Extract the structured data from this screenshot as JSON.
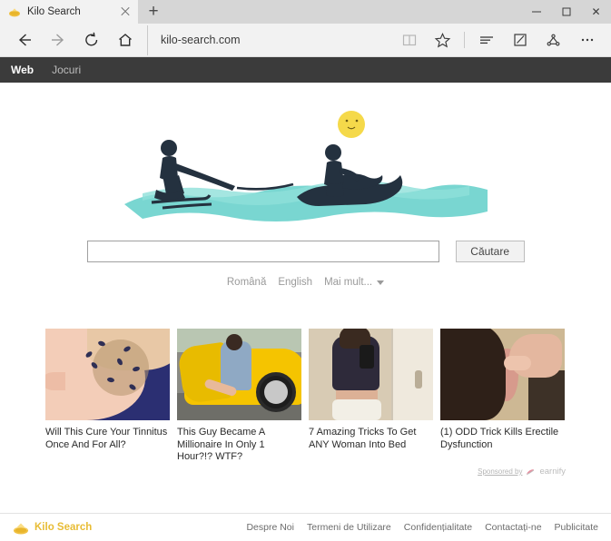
{
  "window": {
    "tab": {
      "title": "Kilo Search",
      "favicon": "kilo-logo-icon",
      "close_icon": "close-icon"
    },
    "new_tab_icon": "plus-icon",
    "controls": {
      "minimize": "minimize-icon",
      "maximize": "maximize-icon",
      "close": "close-icon"
    }
  },
  "toolbar": {
    "back_icon": "back-arrow-icon",
    "forward_icon": "forward-arrow-icon",
    "refresh_icon": "refresh-icon",
    "home_icon": "home-icon",
    "address": "kilo-search.com",
    "reading_view_icon": "book-icon",
    "favorites_icon": "star-icon",
    "hub_icon": "hub-lines-icon",
    "web_note_icon": "pencil-square-icon",
    "share_icon": "share-icon",
    "more_icon": "more-ellipsis-icon"
  },
  "navbar": {
    "items": [
      {
        "label": "Web",
        "active": true
      },
      {
        "label": "Jocuri",
        "active": false
      }
    ]
  },
  "doodle": {
    "name": "water-ski-jetski-doodle",
    "sun": "sun-smiley-icon",
    "water_color": "#5ecfc9",
    "figure_color": "#253241"
  },
  "search": {
    "value": "",
    "placeholder": "",
    "button_label": "Căutare"
  },
  "languages": {
    "items": [
      "Română",
      "English"
    ],
    "more_label": "Mai mult...",
    "caret_icon": "chevron-down-icon"
  },
  "ads": {
    "items": [
      {
        "caption": "Will This Cure Your Tinnitus Once And For All?",
        "thumb": "face-with-insects-illustration"
      },
      {
        "caption": "This Guy Became A Millionaire In Only 1 Hour?!? WTF?",
        "thumb": "man-in-yellow-sports-car-photo"
      },
      {
        "caption": "7 Amazing Tricks To Get ANY Woman Into Bed",
        "thumb": "woman-mirror-selfie-photo"
      },
      {
        "caption": "(1) ODD Trick Kills Erectile Dysfunction",
        "thumb": "hand-touching-ear-photo"
      }
    ],
    "sponsor": {
      "label": "Sponsored by",
      "brand": "earnify",
      "logo_icon": "earnify-logo-icon"
    }
  },
  "footer": {
    "logo_text": "Kilo Search",
    "logo_icon": "kilo-logo-icon",
    "links": [
      "Despre Noi",
      "Termeni de Utilizare",
      "Confidențialitate",
      "Contactați-ne",
      "Publicitate"
    ]
  },
  "colors": {
    "brand_gold": "#e8bc34",
    "navbar_bg": "#3b3b3b",
    "doodle_teal": "#5ecfc9"
  }
}
